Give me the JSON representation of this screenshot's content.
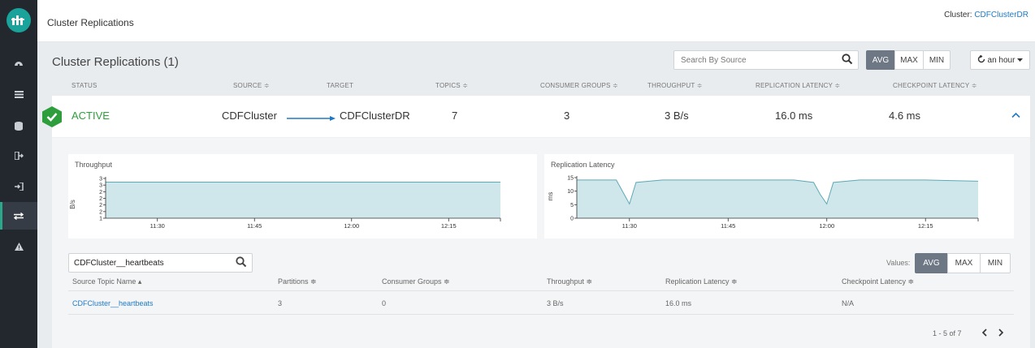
{
  "header": {
    "title": "Cluster Replications",
    "cluster_label": "Cluster:",
    "cluster_name": "CDFClusterDR"
  },
  "sidebar": {
    "icons": [
      "logo-icon",
      "dashboard-icon",
      "list-icon",
      "database-icon",
      "logout-icon",
      "login-icon",
      "replication-icon",
      "alert-icon"
    ]
  },
  "replications": {
    "title": "Cluster Replications (1)",
    "search_placeholder": "Search By Source",
    "aggregations": [
      "AVG",
      "MAX",
      "MIN"
    ],
    "selected_aggregation": "AVG",
    "time_range": "an hour",
    "columns": [
      "STATUS",
      "SOURCE ≑",
      "TARGET",
      "TOPICS ≑",
      "CONSUMER GROUPS ≑",
      "THROUGHPUT ≑",
      "REPLICATION LATENCY ≑",
      "CHECKPOINT LATENCY ≑"
    ],
    "row": {
      "status": "ACTIVE",
      "source": "CDFCluster",
      "target": "CDFClusterDR",
      "topics": "7",
      "consumer_groups": "3",
      "throughput": "3 B/s",
      "replication_latency": "16.0 ms",
      "checkpoint_latency": "4.6 ms"
    }
  },
  "charts": {
    "throughput": {
      "title": "Throughput",
      "ylabel": "B/s",
      "yticks": [
        "3",
        "3",
        "2",
        "2",
        "2",
        "2",
        "1"
      ],
      "xticks": [
        "11:30",
        "11:45",
        "12:00",
        "12:15"
      ]
    },
    "latency": {
      "title": "Replication Latency",
      "ylabel": "ms",
      "yticks": [
        "15",
        "10",
        "5",
        "0"
      ],
      "xticks": [
        "11:30",
        "11:45",
        "12:00",
        "12:15"
      ]
    }
  },
  "chart_data": [
    {
      "type": "area",
      "title": "Throughput",
      "ylabel": "B/s",
      "x": [
        "11:22",
        "11:25",
        "11:30",
        "11:35",
        "11:40",
        "11:45",
        "11:50",
        "11:55",
        "12:00",
        "12:05",
        "12:10",
        "12:15",
        "12:20",
        "12:23"
      ],
      "series": [
        {
          "values": [
            3,
            3,
            3,
            3,
            3,
            3,
            3,
            3,
            3,
            3,
            3,
            3,
            3,
            3
          ]
        }
      ],
      "ylim": [
        1,
        3.2
      ]
    },
    {
      "type": "area",
      "title": "Replication Latency",
      "ylabel": "ms",
      "x": [
        "11:22",
        "11:25",
        "11:28",
        "11:29",
        "11:30",
        "11:31",
        "11:35",
        "11:45",
        "11:55",
        "11:58",
        "11:59",
        "12:00",
        "12:01",
        "12:05",
        "12:15",
        "12:23"
      ],
      "series": [
        {
          "values": [
            16,
            16,
            16,
            11,
            6,
            15,
            16,
            16,
            16,
            15,
            10,
            6,
            15,
            16,
            16,
            15.5
          ]
        }
      ],
      "ylim": [
        0,
        17
      ]
    }
  ],
  "topics": {
    "search_value": "CDFCluster__heartbeats",
    "values_label": "Values:",
    "aggregations": [
      "AVG",
      "MAX",
      "MIN"
    ],
    "selected_aggregation": "AVG",
    "columns": [
      "Source Topic Name ▴",
      "Partitions ≑",
      "Consumer Groups ≑",
      "Throughput ≑",
      "Replication Latency ≑",
      "Checkpoint Latency ≑"
    ],
    "rows": [
      {
        "name": "CDFCluster__heartbeats",
        "partitions": "3",
        "consumer_groups": "0",
        "throughput": "3 B/s",
        "replication_latency": "16.0 ms",
        "checkpoint_latency": "N/A"
      }
    ],
    "pager": "1 - 5 of 7"
  },
  "colors": {
    "accent": "#1f7ac6",
    "active": "#2e9e3c",
    "chart_fill": "#cfe6ea",
    "chart_line": "#5ea9b5",
    "selected_button": "#6d7884"
  }
}
